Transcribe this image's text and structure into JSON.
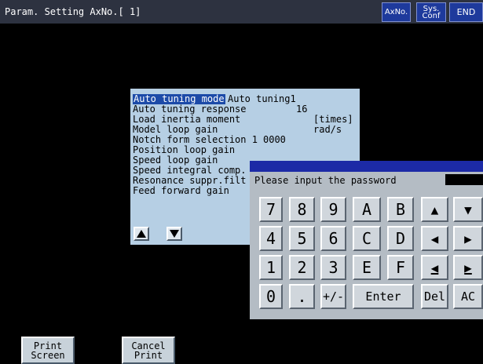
{
  "header": {
    "title": "Param. Setting AxNo.[ 1]",
    "axno_label": "AxNo.",
    "sys_conf_label": "Sys.\nConf",
    "end_label": "END"
  },
  "params": {
    "rows": [
      {
        "label": "Auto tuning mode",
        "value": "Auto tuning1"
      },
      {
        "label": "Auto tuning response",
        "value": "16"
      },
      {
        "label": "Load inertia moment",
        "value": "[times]"
      },
      {
        "label": "Model loop gain",
        "value": "rad/s"
      },
      {
        "label": "Notch form selection 1",
        "value": "0000"
      },
      {
        "label": "Position loop gain",
        "value": ""
      },
      {
        "label": "Speed loop gain",
        "value": ""
      },
      {
        "label": "Speed integral comp.",
        "value": ""
      },
      {
        "label": "Resonance suppr.filt",
        "value": ""
      },
      {
        "label": "Feed forward gain",
        "value": ""
      }
    ]
  },
  "keypad": {
    "prompt": "Please input the password",
    "keys": {
      "k7": "7",
      "k8": "8",
      "k9": "9",
      "kA": "A",
      "kB": "B",
      "k4": "4",
      "k5": "5",
      "k6": "6",
      "kC": "C",
      "kD": "D",
      "k1": "1",
      "k2": "2",
      "k3": "3",
      "kE": "E",
      "kF": "F",
      "k0": "0",
      "dot": ".",
      "plusminus": "+/-",
      "enter": "Enter",
      "del": "Del",
      "ac": "AC"
    },
    "glyphs": {
      "up": "▲",
      "down": "▼",
      "left": "◀",
      "right": "▶",
      "home": "◀",
      "end": "▶"
    }
  },
  "footer": {
    "print_screen": "Print\nScreen",
    "cancel_print": "Cancel\nPrint"
  }
}
